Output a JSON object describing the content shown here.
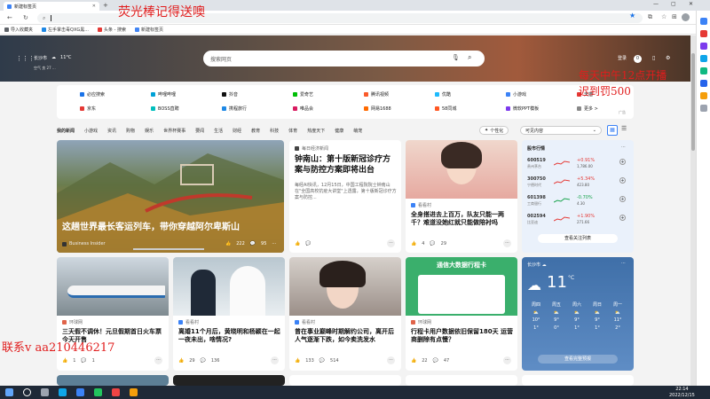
{
  "browser": {
    "tab_title": "新建标签页",
    "address_value": "",
    "bookmarks": [
      "导入收藏夹",
      "左手掌击毒QXG黑...",
      "头条 - 搜索",
      "新建标签页"
    ]
  },
  "hero": {
    "city": "长沙市",
    "temp": "11°C",
    "aqi": "空气 良 27 ...",
    "search_placeholder": "搜索网页",
    "login": "登录",
    "points": "0"
  },
  "quick_links": {
    "row1": [
      "必应搜索",
      "哔哩哔哩",
      "抖音",
      "爱奇艺",
      "腾讯视频",
      "优酷",
      "小游戏",
      "天猫"
    ],
    "row2": [
      "京东",
      "BOSS直聘",
      "携程旅行",
      "唯品会",
      "网易1688",
      "58同城",
      "微软PPT模板",
      "更多 >"
    ],
    "ad": "广告"
  },
  "categories": {
    "items": [
      "我的新闻",
      "小游戏",
      "资讯",
      "购物",
      "娱乐",
      "世界杯赛事",
      "要闻",
      "生活",
      "财经",
      "教育",
      "科技",
      "体育",
      "热度天下",
      "健康",
      "萌宠"
    ],
    "personalize": "个性化",
    "visible_content": "可见内容"
  },
  "cards": {
    "featured": {
      "title": "这趟世界最长客运列车，带你穿越阿尔卑斯山",
      "source": "Business Insider",
      "likes": "222",
      "comments": "95"
    },
    "zhongnanshan": {
      "source": "每日经济新闻",
      "title": "钟南山：第十版新冠诊疗方案与防控方案即将出台",
      "summary": "每经AI快讯，12月15日，中国工程院院士钟南山在\"全国高校抗疫大讲堂\"上透露，第十版新冠诊疗方案与防控..."
    },
    "girl": {
      "source": "看看村",
      "title": "全身搭进去上百万，队友只能一两千？难道没她红就只能做陪衬吗",
      "likes": "4",
      "comments": "29"
    },
    "train": {
      "source": "环球网",
      "title": "三天假不调休！元旦假期首日火车票今天开售",
      "likes": "1",
      "comments": "1"
    },
    "wedding": {
      "source": "看看村",
      "title": "离婚11个月后，黄晓明和杨颖在一起一夜未出，啥情况?",
      "likes": "29",
      "comments": "136"
    },
    "star": {
      "source": "看看村",
      "title": "曾在事业巅峰时期解约公司，离开后人气逐渐下跌，如今卖洗发水",
      "likes": "133",
      "comments": "514"
    },
    "travelcard": {
      "banner": "通信大数据行程卡",
      "source": "环球网",
      "title": "行程卡用户数据依旧保留180天 运营商删除有点慢？",
      "likes": "22",
      "comments": "47"
    }
  },
  "stocks": {
    "title": "股市行情",
    "rows": [
      {
        "code": "600519",
        "name": "贵州茅台",
        "change": "+0.91%",
        "price": "1,786.00"
      },
      {
        "code": "300750",
        "name": "宁德时代",
        "change": "+5.34%",
        "price": "423.80"
      },
      {
        "code": "601398",
        "name": "工商银行",
        "change": "-0.70%",
        "price": "4.30"
      },
      {
        "code": "002594",
        "name": "比亚迪",
        "change": "+1.90%",
        "price": "271.66"
      }
    ],
    "link": "查看关注列表"
  },
  "weather": {
    "city": "长沙市",
    "temp": "11",
    "unit": "°C",
    "days": [
      {
        "day": "周四",
        "hi": "10°",
        "lo": "1°"
      },
      {
        "day": "周五",
        "hi": "9°",
        "lo": "0°"
      },
      {
        "day": "周六",
        "hi": "9°",
        "lo": "1°"
      },
      {
        "day": "周日",
        "hi": "9°",
        "lo": "1°"
      },
      {
        "day": "周一",
        "hi": "11°",
        "lo": "2°"
      }
    ],
    "link": "查看完整预报"
  },
  "overlays": {
    "top": "荧光棒记得送噢",
    "right1": "每天中午12点开播",
    "right2": "迟到罚500",
    "bottom": "联系v aa210446217"
  },
  "taskbar": {
    "time": "22:14",
    "date": "2022/12/15"
  }
}
